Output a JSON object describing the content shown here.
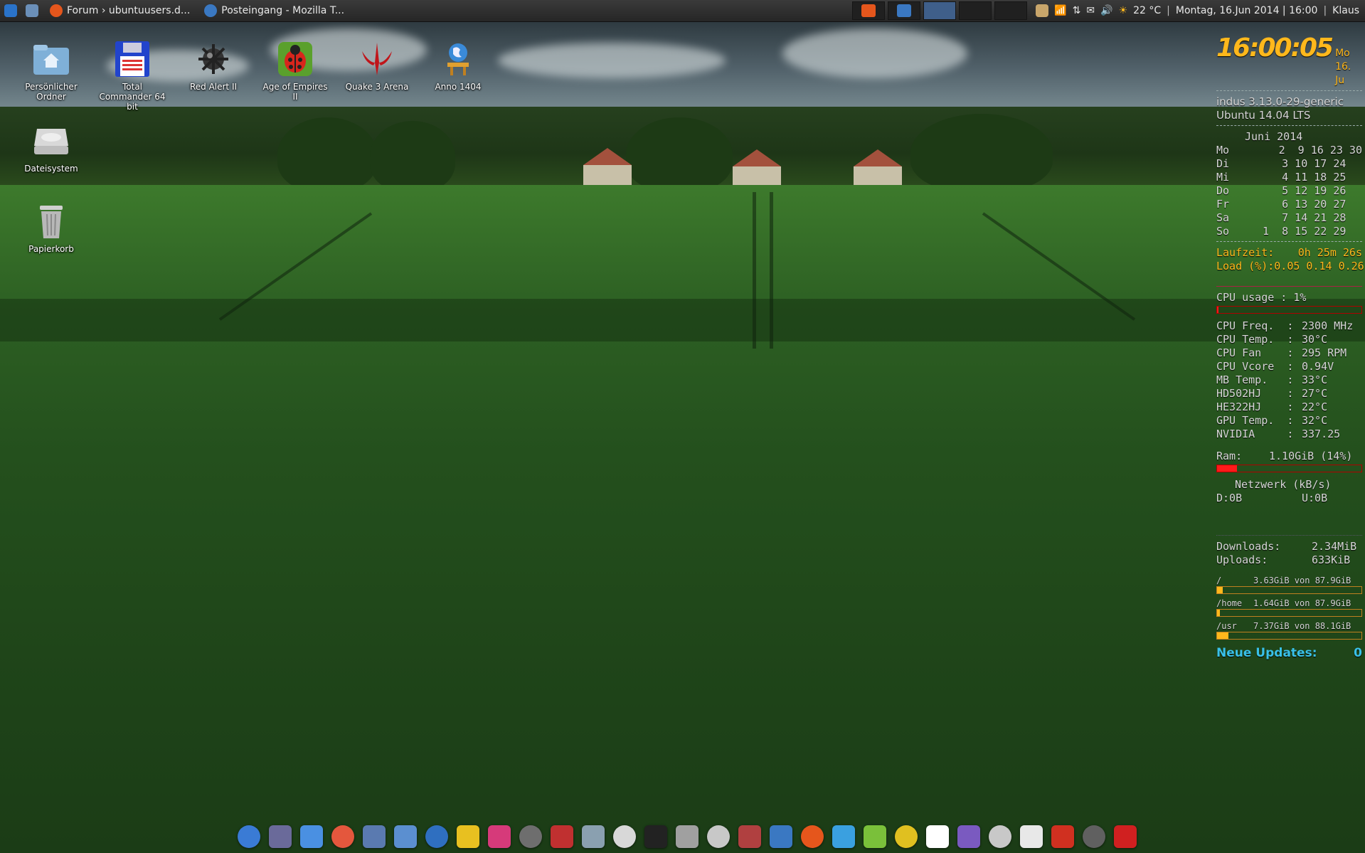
{
  "panel": {
    "tasks": [
      {
        "label": "Forum › ubuntuusers.d...",
        "icon": "firefox-icon"
      },
      {
        "label": "Posteingang - Mozilla T...",
        "icon": "thunderbird-icon"
      }
    ],
    "weather": "22 °C",
    "separator": "|",
    "datetime": "Montag, 16.Jun 2014 | 16:00",
    "user": "Klaus"
  },
  "desktop_icons": [
    {
      "label": "Persönlicher Ordner",
      "icon": "home-folder-icon"
    },
    {
      "label": "Total Commander 64 bit",
      "icon": "floppy-icon"
    },
    {
      "label": "Red Alert II",
      "icon": "mine-icon"
    },
    {
      "label": "Age of Empires II",
      "icon": "ladybug-icon"
    },
    {
      "label": "Quake 3 Arena",
      "icon": "quake-icon"
    },
    {
      "label": "Anno 1404",
      "icon": "globe-icon"
    },
    {
      "label": "Dateisystem",
      "icon": "drive-icon"
    },
    {
      "label": "Papierkorb",
      "icon": "trash-icon"
    }
  ],
  "conky": {
    "time": "16:00:05",
    "date_short": "Mo 16. Ju",
    "host": "indus 3.13.0-29-generic",
    "os": "Ubuntu 14.04 LTS",
    "calendar_title": "Juni 2014",
    "calendar": [
      {
        "day": "Mo",
        "dates": "    2  9 16 23 30"
      },
      {
        "day": "Di",
        "dates": "    3 10 17 24"
      },
      {
        "day": "Mi",
        "dates": "    4 11 18 25"
      },
      {
        "day": "Do",
        "dates": "    5 12 19 26"
      },
      {
        "day": "Fr",
        "dates": "    6 13 20 27"
      },
      {
        "day": "Sa",
        "dates": "    7 14 21 28"
      },
      {
        "day": "So",
        "dates": " 1  8 15 22 29"
      }
    ],
    "uptime_label": "Laufzeit:",
    "uptime_value": "0h 25m 26s",
    "load_label": "Load (%):",
    "load_value": "0.05 0.14 0.26",
    "cpu_usage": "CPU usage : 1%",
    "cpu_usage_fraction": 0.01,
    "sensors": [
      {
        "k": "CPU Freq.  :",
        "v": "2300 MHz"
      },
      {
        "k": "CPU Temp.  :",
        "v": "30°C"
      },
      {
        "k": "CPU Fan    :",
        "v": "295 RPM"
      },
      {
        "k": "CPU Vcore  :",
        "v": "0.94V"
      },
      {
        "k": "MB Temp.   :",
        "v": "33°C"
      },
      {
        "k": "HD502HJ    :",
        "v": "27°C"
      },
      {
        "k": "HE322HJ    :",
        "v": "22°C"
      },
      {
        "k": "GPU Temp.  :",
        "v": "32°C"
      },
      {
        "k": "NVIDIA     :",
        "v": "337.25"
      }
    ],
    "ram_label": "Ram:",
    "ram_value": "1.10GiB (14%)",
    "ram_fraction": 0.14,
    "net_title": "Netzwerk (kB/s)",
    "net_down": "D:0B",
    "net_up": "U:0B",
    "downloads_label": "Downloads:",
    "downloads_value": "2.34MiB",
    "uploads_label": "Uploads:",
    "uploads_value": "633KiB",
    "filesystems": [
      {
        "mount": "/",
        "usage": "3.63GiB von 87.9GiB",
        "fraction": 0.04
      },
      {
        "mount": "/home",
        "usage": "1.64GiB von 87.9GiB",
        "fraction": 0.02
      },
      {
        "mount": "/usr",
        "usage": "7.37GiB von 88.1GiB",
        "fraction": 0.08
      }
    ],
    "updates_label": "Neue Updates:",
    "updates_value": "0"
  },
  "dock_icons": [
    "crossed-tools-icon",
    "lock-icon",
    "system-monitor-icon",
    "pie-chart-icon",
    "calculator-icon",
    "gear-icon",
    "earth-icon",
    "color-wheel-icon",
    "aperture-icon",
    "gimp-icon",
    "audio-editor-icon",
    "text-editor-icon",
    "notepad-icon",
    "terminal-icon",
    "magnifier-icon",
    "window-switcher-icon",
    "network-tools-icon",
    "thunderbird-icon",
    "firefox-icon",
    "download-icon",
    "puzzle-icon",
    "headphones-icon",
    "cell-icon",
    "sword-icon",
    "warlock-icon",
    "cards-icon",
    "boat-icon",
    "activity-monitor-icon",
    "power-icon"
  ]
}
